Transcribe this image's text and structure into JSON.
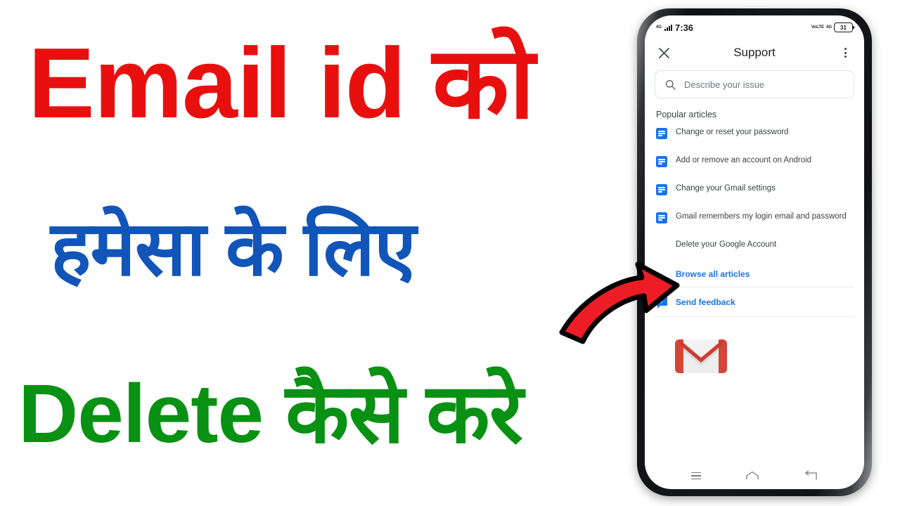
{
  "thumbnail": {
    "line1": "Email id को",
    "line2": "हमेसा के लिए",
    "line3": "Delete कैसे करे",
    "colors": {
      "line1": "#e8100f",
      "line2": "#1155b8",
      "line3": "#089113",
      "arrow_fill": "#ee1c25",
      "arrow_stroke": "#000000"
    }
  },
  "phone": {
    "status_bar": {
      "network_label": "4G",
      "time": "7:36",
      "volte_label": "VoLTE",
      "right_network_label": "4G",
      "battery_level": "31"
    },
    "app_bar": {
      "close_icon": "close-icon",
      "title": "Support",
      "overflow_icon": "kebab-menu-icon"
    },
    "search": {
      "icon": "search-icon",
      "placeholder": "Describe your issue"
    },
    "popular_articles": {
      "section_title": "Popular articles",
      "items": [
        {
          "label": "Change or reset your password",
          "has_icon": true
        },
        {
          "label": "Add or remove an account on Android",
          "has_icon": true
        },
        {
          "label": "Change your Gmail settings",
          "has_icon": true
        },
        {
          "label": "Gmail remembers my login email and password",
          "has_icon": true
        },
        {
          "label": "Delete your Google Account",
          "has_icon": false
        }
      ],
      "browse_all_label": "Browse all articles"
    },
    "feedback": {
      "icon": "feedback-bubble-icon",
      "label": "Send feedback"
    },
    "branding": {
      "logo": "gmail-logo"
    },
    "nav_bar": {
      "recents": "recents-icon",
      "home": "home-icon",
      "back": "back-icon"
    }
  }
}
